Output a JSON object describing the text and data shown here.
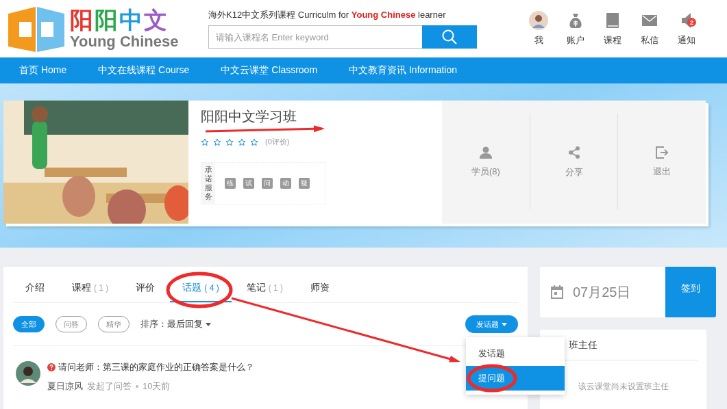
{
  "header": {
    "logo_text": "阳阳中文",
    "logo_subtitle": "Young Chinese",
    "tagline": "海外K12中文系列课程 Curriculm for **Young Chinese** learner",
    "search": {
      "placeholder": "请输入课程名 Enter keyword"
    },
    "user_menu": [
      {
        "label": "我",
        "kind": "avatar"
      },
      {
        "label": "账户",
        "kind": "moneybag"
      },
      {
        "label": "课程",
        "kind": "book"
      },
      {
        "label": "私信",
        "kind": "mail"
      },
      {
        "label": "通知",
        "kind": "speaker",
        "badge": "2"
      }
    ]
  },
  "nav": [
    "首页 Home",
    "中文在线课程 Course",
    "中文云课堂 Classroom",
    "中文教育资讯 Information"
  ],
  "class_card": {
    "title": "阳阳中文学习班",
    "stars": 0,
    "rating_count": "(0评价)",
    "promise_label": "承诺服务",
    "promises": [
      "练",
      "试",
      "问",
      "动",
      "疑"
    ],
    "actions": [
      {
        "label": "学员(8)",
        "kind": "person"
      },
      {
        "label": "分享",
        "kind": "share"
      },
      {
        "label": "退出",
        "kind": "exit"
      }
    ]
  },
  "tabs": [
    {
      "label": "介绍",
      "selected": false
    },
    {
      "label": "课程",
      "count": "( 1 )",
      "selected": false
    },
    {
      "label": "评价",
      "selected": false
    },
    {
      "label": "话题",
      "count": "( 4 )",
      "selected": true
    },
    {
      "label": "笔记",
      "count": "( 1 )",
      "selected": false
    },
    {
      "label": "师资",
      "selected": false
    }
  ],
  "filters": [
    {
      "label": "全部",
      "selected": true
    },
    {
      "label": "问答",
      "selected": false
    },
    {
      "label": "精华",
      "selected": false
    }
  ],
  "sort": {
    "label": "排序：",
    "value": "最后回复"
  },
  "post_button": "发话题",
  "dropdown": [
    {
      "label": "发话题",
      "selected": false
    },
    {
      "label": "提问题",
      "selected": true
    }
  ],
  "topics": [
    {
      "kind": "question",
      "title": "请问老师：第三课的家庭作业的正确答案是什么？",
      "author": "夏日凉风",
      "action": "发起了问答",
      "time": "10天前"
    }
  ],
  "checkin": {
    "date": "07月25日",
    "button": "签到"
  },
  "head_teacher": {
    "title": "班主任",
    "empty_text": "该云课堂尚未设置班主任"
  }
}
